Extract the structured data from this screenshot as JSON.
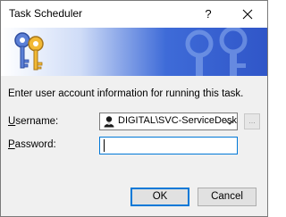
{
  "window": {
    "title": "Task Scheduler",
    "help_glyph": "?",
    "close_icon": "close-icon"
  },
  "banner": {
    "logo_icon": "keys-icon",
    "accent_color": "#3056c8"
  },
  "form": {
    "prompt": "Enter user account information for running this task.",
    "username_label_accel": "U",
    "username_label_rest": "sername:",
    "username_value": "DIGITAL\\SVC-ServiceDesk",
    "password_label_accel": "P",
    "password_label_rest": "assword:",
    "password_value": "",
    "browse_label": "..."
  },
  "buttons": {
    "ok": "OK",
    "cancel": "Cancel",
    "focus_color": "#0078d7"
  }
}
